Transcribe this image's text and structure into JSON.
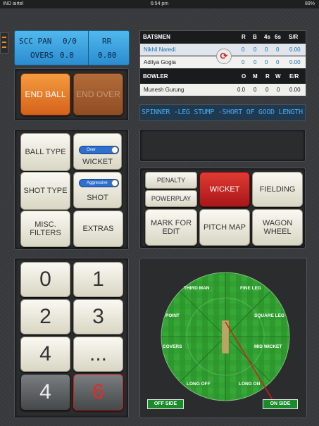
{
  "status_bar": {
    "carrier": "IND airtel",
    "time": "6:54 pm",
    "battery": "89%"
  },
  "score": {
    "team_label": "SCC PAN",
    "score": "0/0",
    "overs_label": "OVERS",
    "overs": "0.0",
    "rr_label": "RR",
    "rr": "0.00"
  },
  "batsmen_table": {
    "header": [
      "BATSMEN",
      "R",
      "B",
      "4s",
      "6s",
      "S/R"
    ],
    "rows": [
      [
        "Nikhil Naredi",
        "0",
        "0",
        "0",
        "0",
        "0.00"
      ],
      [
        "Aditya Gogia",
        "0",
        "0",
        "0",
        "0",
        "0.00"
      ]
    ]
  },
  "bowler_table": {
    "header": [
      "BOWLER",
      "O",
      "M",
      "R",
      "W",
      "E/R"
    ],
    "rows": [
      [
        "Munesh Gurung",
        "0.0",
        "0",
        "0",
        "0",
        "0.00"
      ]
    ]
  },
  "commentary": "SPINNER -LEG STUMP -SHORT OF GOOD LENGTH",
  "ball_buttons": {
    "end_ball": "END BALL",
    "end_over": "END OVER"
  },
  "options": {
    "ball_type": "BALL TYPE",
    "wicket_toggle": "Over",
    "wicket": "WICKET",
    "shot_type": "SHOT TYPE",
    "shot_toggle": "Aggressive",
    "shot": "SHOT",
    "misc_filters": "MISC. FILTERS",
    "extras": "EXTRAS"
  },
  "actions": {
    "penalty": "PENALTY",
    "powerplay": "POWERPLAY",
    "wicket": "WICKET",
    "fielding": "FIELDING",
    "mark_for_edit": "MARK FOR EDIT",
    "pitch_map": "PITCH MAP",
    "wagon_wheel": "WAGON WHEEL"
  },
  "runs": {
    "zero": "0",
    "one": "1",
    "two": "2",
    "three": "3",
    "four": "4",
    "more": "...",
    "boundary_four": "4",
    "boundary_six": "6"
  },
  "field": {
    "labels": {
      "third_man": "THIRD MAN",
      "fine_leg": "FINE LEG",
      "point": "POINT",
      "square_leg": "SQUARE LEG",
      "covers": "COVERS",
      "mid_wicket": "MID WICKET",
      "long_off": "LONG OFF",
      "long_on": "LONG ON"
    },
    "off_side": "OFF SIDE",
    "on_side": "ON SIDE"
  },
  "colors": {
    "accent": "#f08a1c",
    "score_blue": "#3aa3e3",
    "grass": "#2e9a2e",
    "wicket_red": "#c8211e"
  }
}
